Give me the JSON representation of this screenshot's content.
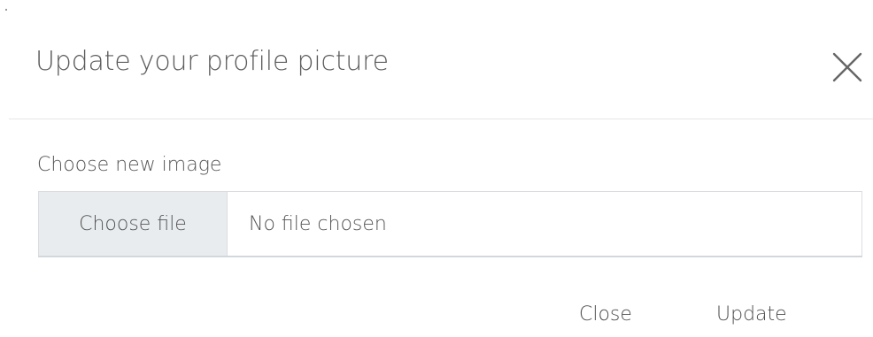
{
  "modal": {
    "title": "Update your profile picture",
    "close_icon": "close-icon"
  },
  "form": {
    "label": "Choose new image",
    "file_button": "Choose file",
    "file_status": "No file chosen"
  },
  "footer": {
    "close_label": "Close",
    "update_label": "Update"
  }
}
